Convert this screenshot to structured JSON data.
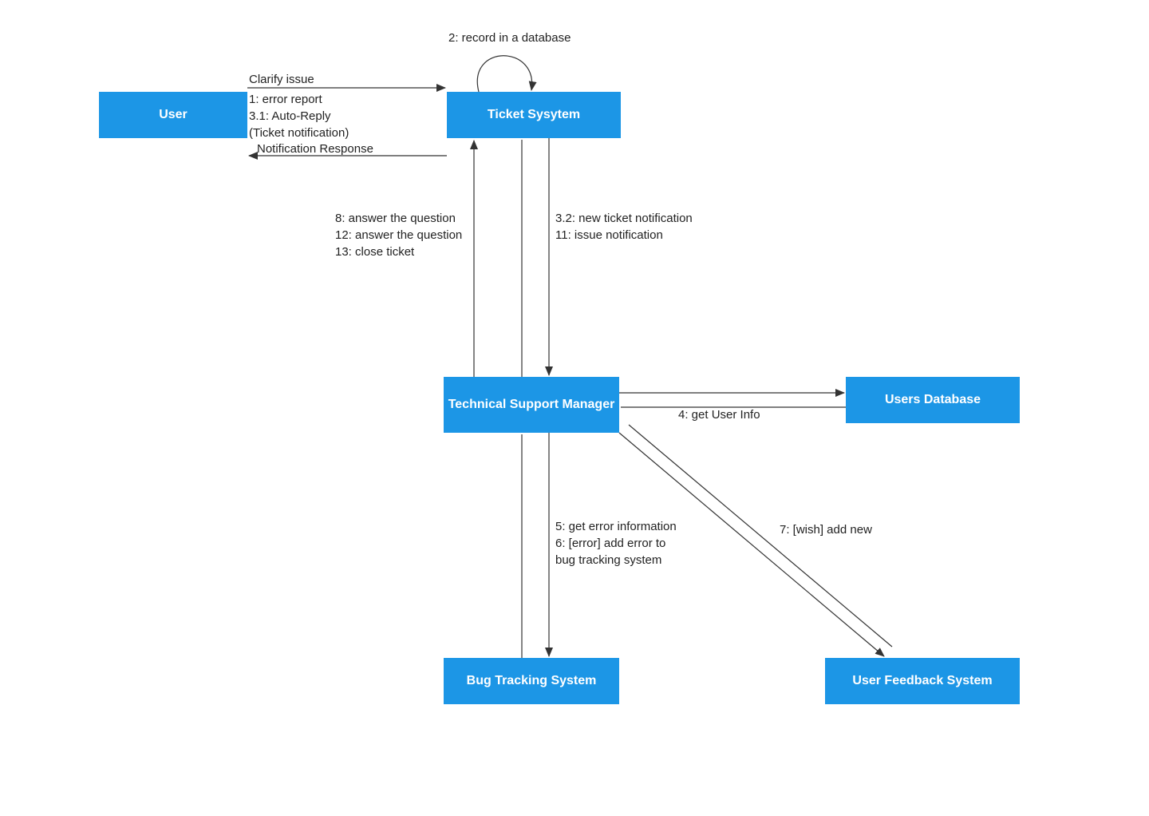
{
  "nodes": {
    "user": "User",
    "ticket_system": "Ticket Sysytem",
    "tech_support": "Technical Support Manager",
    "users_db": "Users Database",
    "bug_tracking": "Bug Tracking System",
    "user_feedback": "User Feedback System"
  },
  "edges": {
    "clarify_issue": "Clarify issue",
    "error_report": "1: error report",
    "auto_reply_1": "3.1: Auto-Reply",
    "auto_reply_2": "(Ticket notification)",
    "notification_response": "Notification Response",
    "record_db": "2: record in a database",
    "new_ticket_1": "3.2: new ticket notification",
    "new_ticket_2": "11: issue notification",
    "answer_1": "8: answer the question",
    "answer_2": "12: answer the question",
    "answer_3": "13: close ticket",
    "get_user_info": "4: get User Info",
    "get_error_1": "5: get error information",
    "get_error_2": "6: [error] add error to",
    "get_error_3": "bug tracking system",
    "wish_add_new": "7: [wish] add new"
  },
  "colors": {
    "node": "#1c96e6",
    "line": "#333333"
  }
}
